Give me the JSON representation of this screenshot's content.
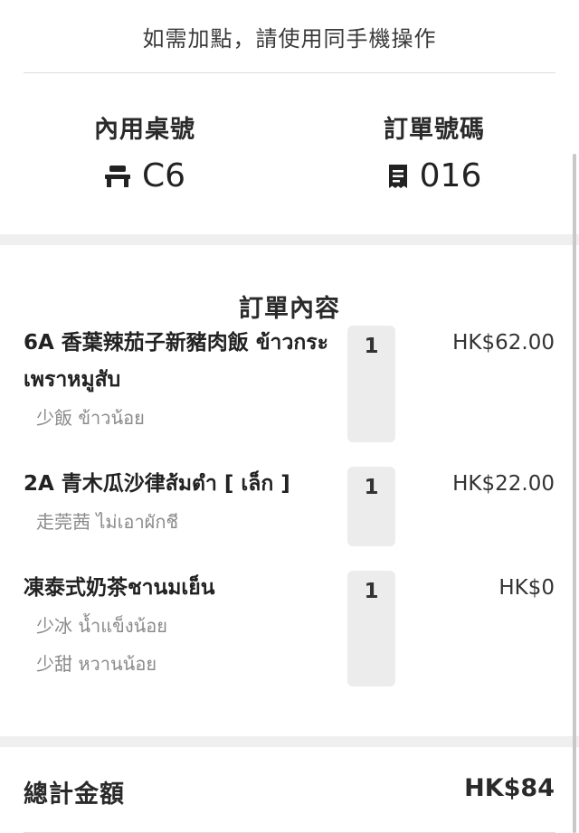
{
  "notice": "如需加點，請使用同手機操作",
  "table": {
    "label": "內用桌號",
    "value": "C6",
    "icon": "table-icon"
  },
  "order_no": {
    "label": "訂單號碼",
    "value": "016",
    "icon": "receipt-icon"
  },
  "order": {
    "title": "訂單內容",
    "items": [
      {
        "name": "6A 香葉辣茄子新豬肉飯 ข้าวกระเพราหมูสับ",
        "qty": "1",
        "price": "HK$62.00",
        "options": [
          "少飯 ข้าวน้อย"
        ]
      },
      {
        "name": "2A 青木瓜沙律ส้มตำ [ เล็ก ]",
        "qty": "1",
        "price": "HK$22.00",
        "options": [
          "走莞茜 ไม่เอาผักชี"
        ]
      },
      {
        "name": "凍泰式奶茶ชานมเย็น",
        "qty": "1",
        "price": "HK$0",
        "options": [
          "少冰 น้ำแข็งน้อย",
          "少甜 หวานน้อย"
        ]
      }
    ]
  },
  "total": {
    "label": "總計金額",
    "value": "HK$84"
  },
  "colors": {
    "band": "#efefef",
    "qty_bg": "#ececec",
    "option_text": "#8a8a8a"
  }
}
